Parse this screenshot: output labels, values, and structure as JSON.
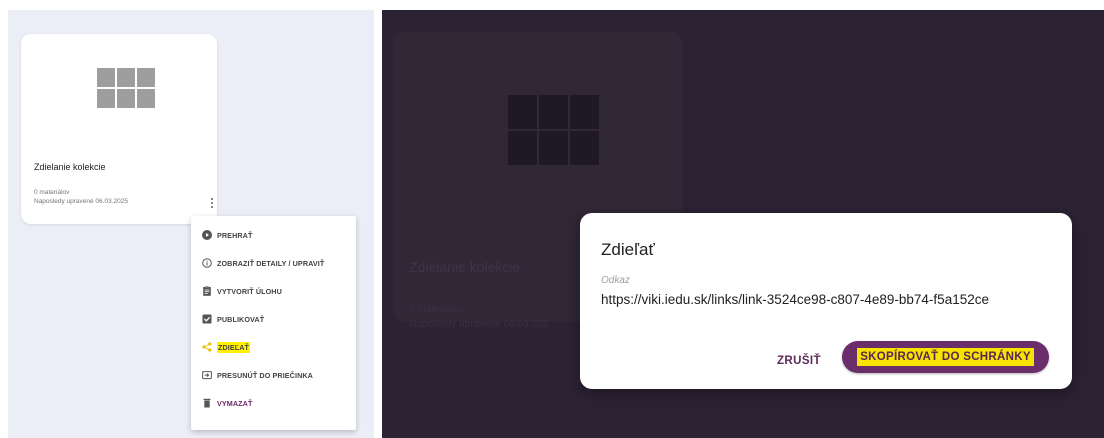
{
  "colors": {
    "accent": "#6a2e6a",
    "highlight": "#fff200",
    "overlay": "#2b2233",
    "left_background": "#eceef7"
  },
  "card": {
    "title": "Zdielanie kolekcie",
    "materials": "0 materiálov",
    "last_edited": "Naposledy upravené 06.03.2025",
    "icon": "grid-icon",
    "menu_icon": "more-vertical-icon"
  },
  "menu": {
    "items": [
      {
        "label": "PREHRAŤ",
        "icon": "play-circle-icon"
      },
      {
        "label": "ZOBRAZIŤ DETAILY / UPRAVIŤ",
        "icon": "info-circle-icon"
      },
      {
        "label": "VYTVORIŤ ÚLOHU",
        "icon": "clipboard-icon"
      },
      {
        "label": "PUBLIKOVAŤ",
        "icon": "check-box-icon"
      },
      {
        "label": "ZDIEĽAŤ",
        "icon": "share-icon"
      },
      {
        "label": "PRESUNÚŤ DO PRIEČINKA",
        "icon": "move-to-folder-icon"
      },
      {
        "label": "VYMAZAŤ",
        "icon": "trash-icon"
      }
    ]
  },
  "background_card": {
    "title": "Zdielanie kolekcie",
    "materials": "0 materiálov",
    "last_edited": "Naposledy upravené 06.03.202"
  },
  "dialog": {
    "title": "Zdieľať",
    "field_label": "Odkaz",
    "link": "https://viki.iedu.sk/links/link-3524ce98-c807-4e89-bb74-f5a152ce",
    "cancel_label": "ZRUŠIŤ",
    "copy_label": "SKOPÍROVAŤ DO SCHRÁNKY"
  }
}
